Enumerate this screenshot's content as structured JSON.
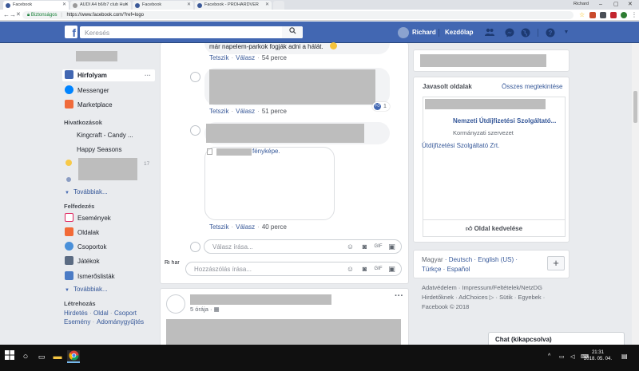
{
  "browser": {
    "tabs": [
      {
        "label": "Facebook",
        "active": true
      },
      {
        "label": "AUDI A4 b6/b7 club Hun"
      },
      {
        "label": "Facebook"
      },
      {
        "label": "Facebook - PROHARDVER"
      }
    ],
    "profile_name": "Richard",
    "secure_label": "Biztonságos",
    "url": "https://www.facebook.com/?ref=logo"
  },
  "fb": {
    "logo": "f",
    "search_placeholder": "Keresés",
    "user_name": "Richard",
    "home_label": "Kezdőlap"
  },
  "left": {
    "news_feed": "Hírfolyam",
    "messenger": "Messenger",
    "marketplace": "Marketplace",
    "shortcuts_heading": "Hivatkozások",
    "shortcuts": [
      "Kingcraft - Candy ...",
      "Happy Seasons"
    ],
    "shortcut_count": "17",
    "more1": "Továbbiak...",
    "explore_heading": "Felfedezés",
    "explore": [
      "Események",
      "Oldalak",
      "Csoportok",
      "Játékok",
      "Ismerőslisták"
    ],
    "more2": "Továbbiak...",
    "create_heading": "Létrehozás",
    "create_links": [
      "Hirdetés",
      "Oldal",
      "Csoport",
      "Esemény",
      "Adománygyűjtés"
    ]
  },
  "feed": {
    "top_text": "már napelem-parkok fogják adni a hálát.",
    "comment1": {
      "actions": [
        "Tetszik",
        "Válasz"
      ],
      "time": "54 perce"
    },
    "comment2": {
      "actions": [
        "Tetszik",
        "Válasz"
      ],
      "time": "51 perce",
      "reactions": "1"
    },
    "comment3": {
      "actions": [
        "Tetszik",
        "Válasz"
      ],
      "time": "40 perce",
      "image_alt": "fényképe."
    },
    "reply_placeholder": "Válasz írása...",
    "comment_placeholder": "Hozzászólás írása...",
    "commenter_alt": "Ri har",
    "post2": {
      "time": "5 órája",
      "menu": "···"
    }
  },
  "right": {
    "suggested_title": "Javasolt oldalak",
    "see_all": "Összes megtekintése",
    "page_name": "Nemzeti Útdíjfizetési Szolgáltató...",
    "page_category": "Kormányzati szervezet",
    "page_image_alt": "Útdíjfizetési Szolgáltató Zrt.",
    "like_page": "Oldal kedvelése",
    "languages": [
      "Magyar",
      "Deutsch",
      "English (US)",
      "Türkçe",
      "Español"
    ],
    "footer_links": [
      "Adatvédelem",
      "Impressum/Feltételek/NetzDG",
      "Hirdetőknek",
      "AdChoices",
      "Sütik",
      "Egyebek"
    ],
    "copyright": "Facebook © 2018"
  },
  "chat": {
    "label": "Chat (kikapcsolva)"
  },
  "taskbar": {
    "time": "21:31",
    "date": "2018. 05. 04."
  }
}
